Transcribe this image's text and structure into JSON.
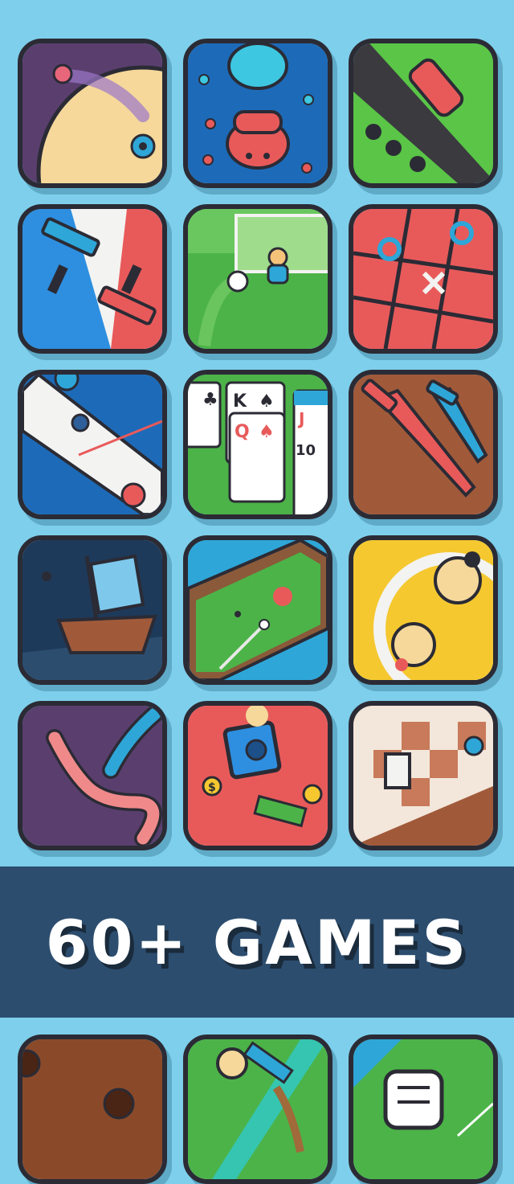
{
  "banner": {
    "title": "60+ GAMES"
  },
  "games_row1": [
    {
      "name": "spikes-game-icon"
    },
    {
      "name": "hippo-game-icon"
    },
    {
      "name": "race-car-game-icon"
    }
  ],
  "games_row2": [
    {
      "name": "paint-roller-game-icon"
    },
    {
      "name": "soccer-game-icon"
    },
    {
      "name": "tic-tac-toe-game-icon"
    }
  ],
  "games_row3": [
    {
      "name": "air-hockey-game-icon"
    },
    {
      "name": "solitaire-game-icon",
      "card_labels": [
        "K",
        "Q",
        "J",
        "10"
      ]
    },
    {
      "name": "sword-game-icon"
    }
  ],
  "games_row4": [
    {
      "name": "pirate-ship-game-icon"
    },
    {
      "name": "pool-billiards-game-icon"
    },
    {
      "name": "sumo-game-icon"
    }
  ],
  "games_row5": [
    {
      "name": "snake-worm-game-icon"
    },
    {
      "name": "safe-heist-game-icon",
      "coin_label": "$"
    },
    {
      "name": "chess-game-icon"
    }
  ],
  "games_row6": [
    {
      "name": "brown-holes-game-icon"
    },
    {
      "name": "tug-of-war-game-icon"
    },
    {
      "name": "rock-paper-scissors-game-icon"
    }
  ]
}
